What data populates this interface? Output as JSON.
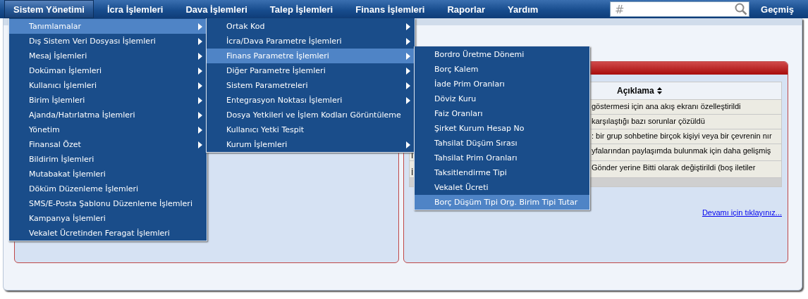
{
  "menu_bar": {
    "items": [
      {
        "label": "Sistem Yönetimi",
        "selected": true
      },
      {
        "label": "İcra İşlemleri",
        "selected": false
      },
      {
        "label": "Dava İşlemleri",
        "selected": false
      },
      {
        "label": "Talep İşlemleri",
        "selected": false
      },
      {
        "label": "Finans İşlemleri",
        "selected": false
      },
      {
        "label": "Raporlar",
        "selected": false
      },
      {
        "label": "Yardım",
        "selected": false
      }
    ],
    "search": {
      "placeholder": "#"
    },
    "history_button": "Geçmiş"
  },
  "menus": [
    {
      "items": [
        {
          "label": "Tanımlamalar",
          "has_submenu": true,
          "selected": true
        },
        {
          "label": "Dış Sistem Veri Dosyası İşlemleri",
          "has_submenu": true,
          "selected": false
        },
        {
          "label": "Mesaj İşlemleri",
          "has_submenu": true,
          "selected": false
        },
        {
          "label": "Doküman İşlemleri",
          "has_submenu": true,
          "selected": false
        },
        {
          "label": "Kullanıcı İşlemleri",
          "has_submenu": true,
          "selected": false
        },
        {
          "label": "Birim İşlemleri",
          "has_submenu": true,
          "selected": false
        },
        {
          "label": "Ajanda/Hatırlatma İşlemleri",
          "has_submenu": true,
          "selected": false
        },
        {
          "label": "Yönetim",
          "has_submenu": true,
          "selected": false
        },
        {
          "label": "Finansal Özet",
          "has_submenu": true,
          "selected": false
        },
        {
          "label": "Bildirim İşlemleri",
          "has_submenu": false,
          "selected": false
        },
        {
          "label": "Mutabakat İşlemleri",
          "has_submenu": false,
          "selected": false
        },
        {
          "label": "Döküm Düzenleme İşlemleri",
          "has_submenu": false,
          "selected": false
        },
        {
          "label": "SMS/E-Posta Şablonu Düzenleme İşlemleri",
          "has_submenu": false,
          "selected": false
        },
        {
          "label": "Kampanya İşlemleri",
          "has_submenu": false,
          "selected": false
        },
        {
          "label": "Vekalet Ücretinden Feragat İşlemleri",
          "has_submenu": false,
          "selected": false
        }
      ]
    },
    {
      "items": [
        {
          "label": "Ortak Kod",
          "has_submenu": true,
          "selected": false
        },
        {
          "label": "İcra/Dava Parametre İşlemleri",
          "has_submenu": true,
          "selected": false
        },
        {
          "label": "Finans Parametre İşlemleri",
          "has_submenu": true,
          "selected": true
        },
        {
          "label": "Diğer Parametre İşlemleri",
          "has_submenu": true,
          "selected": false
        },
        {
          "label": "Sistem Parametreleri",
          "has_submenu": true,
          "selected": false
        },
        {
          "label": "Entegrasyon Noktası İşlemleri",
          "has_submenu": true,
          "selected": false
        },
        {
          "label": "Dosya Yetkileri ve İşlem Kodları Görüntüleme",
          "has_submenu": false,
          "selected": false
        },
        {
          "label": "Kullanıcı Yetki Tespit",
          "has_submenu": false,
          "selected": false
        },
        {
          "label": "Kurum İşlemleri",
          "has_submenu": true,
          "selected": false
        }
      ]
    },
    {
      "items": [
        {
          "label": "Bordro Üretme Dönemi",
          "has_submenu": false,
          "selected": false
        },
        {
          "label": "Borç Kalem",
          "has_submenu": false,
          "selected": false
        },
        {
          "label": "İade Prim Oranları",
          "has_submenu": false,
          "selected": false
        },
        {
          "label": "Döviz Kuru",
          "has_submenu": false,
          "selected": false
        },
        {
          "label": "Faiz Oranları",
          "has_submenu": false,
          "selected": false
        },
        {
          "label": "Şirket Kurum Hesap No",
          "has_submenu": false,
          "selected": false
        },
        {
          "label": "Tahsilat Düşüm Sırası",
          "has_submenu": false,
          "selected": false
        },
        {
          "label": "Tahsilat Prim Oranları",
          "has_submenu": false,
          "selected": false
        },
        {
          "label": "Taksitlendirme Tipi",
          "has_submenu": false,
          "selected": false
        },
        {
          "label": "Vekalet Ücreti",
          "has_submenu": false,
          "selected": false
        },
        {
          "label": "Borç Düşüm Tipi Org. Birim Tipi Tutar",
          "has_submenu": false,
          "selected": true
        }
      ]
    }
  ],
  "news_table": {
    "columns": [
      "Açıklama"
    ],
    "rows": [
      {
        "column_1": "",
        "description": "göstermesi için ana akış ekranı özelleştirildi"
      },
      {
        "column_1": "",
        "description": "karşılaştığı bazı sorunlar çözüldü"
      },
      {
        "column_1": "",
        "description": ": bir grup sohbetine birçok kişiyi veya bir çevrenin nır"
      },
      {
        "column_1": "İ",
        "description": "yfalarından paylaşımda bulunmak için daha gelişmiş"
      },
      {
        "column_1": "İ",
        "description": "Gönder yerine Bitti olarak değiştirildi (boş iletiler"
      }
    ]
  },
  "more_link": "Devamı için tıklayınız..."
}
